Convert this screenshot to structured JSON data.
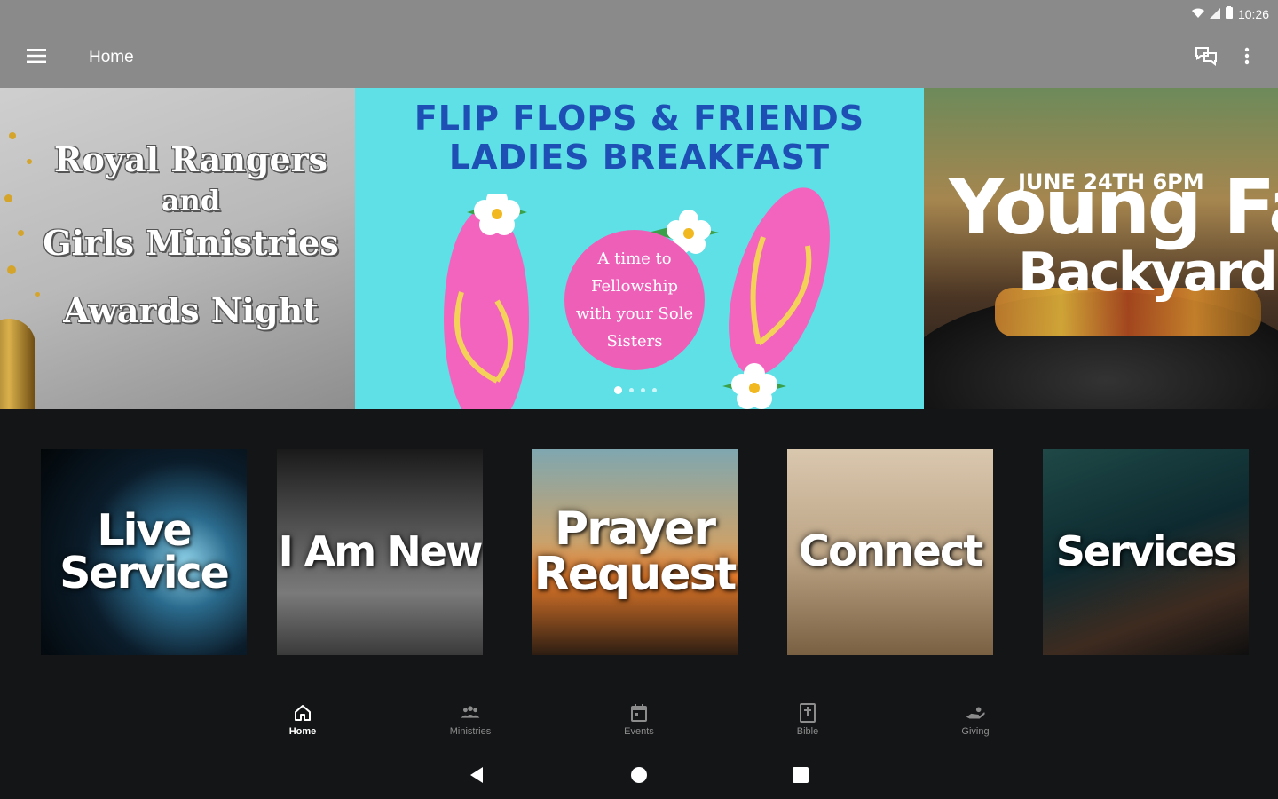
{
  "status_bar": {
    "time": "10:26"
  },
  "app_bar": {
    "title": "Home"
  },
  "carousel": {
    "slides": [
      {
        "lines": [
          "Royal Rangers",
          "and",
          "Girls Ministries",
          "Awards Night"
        ]
      },
      {
        "title_lines": [
          "FLIP FLOPS & FRIENDS",
          "LADIES BREAKFAST"
        ],
        "bubble_lines": [
          "A time to",
          "Fellowship",
          "with your Sole",
          "Sisters"
        ]
      },
      {
        "date": "JUNE 24TH 6PM",
        "title": "Young Fa",
        "subtitle": "Backyard"
      }
    ],
    "active_index": 0,
    "dot_count": 4
  },
  "tiles": [
    {
      "label_lines": [
        "Live",
        "Service"
      ]
    },
    {
      "label_lines": [
        "I Am New"
      ]
    },
    {
      "label_lines": [
        "Prayer",
        "Request"
      ]
    },
    {
      "label_lines": [
        "Connect"
      ]
    },
    {
      "label_lines": [
        "Services"
      ]
    }
  ],
  "bottom_nav": {
    "items": [
      {
        "label": "Home",
        "icon": "home-icon",
        "active": true
      },
      {
        "label": "Ministries",
        "icon": "people-icon",
        "active": false
      },
      {
        "label": "Events",
        "icon": "calendar-icon",
        "active": false
      },
      {
        "label": "Bible",
        "icon": "bible-icon",
        "active": false
      },
      {
        "label": "Giving",
        "icon": "giving-icon",
        "active": false
      }
    ]
  },
  "colors": {
    "app_bar": "#8a8a8a",
    "background": "#141517",
    "flip_bg": "#5ee0e6",
    "flip_title": "#1d4fb4",
    "bubble": "#ee5fb8",
    "flipflop": "#f264bd",
    "strap": "#f4d25a"
  }
}
